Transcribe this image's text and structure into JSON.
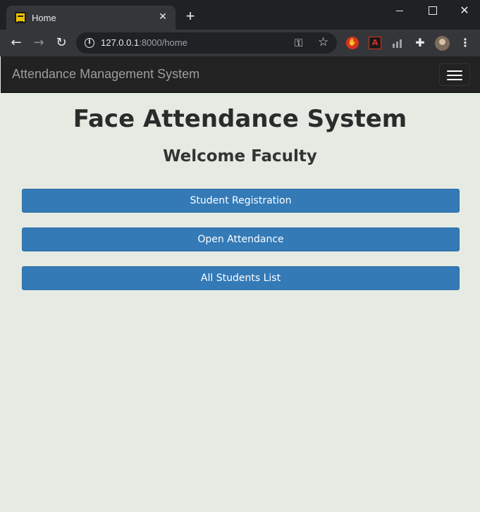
{
  "browser": {
    "tab_title": "Home",
    "tab_close_glyph": "✕",
    "new_tab_glyph": "+",
    "url_host": "127.0.0.1",
    "url_rest": ":8000/home",
    "icons": [
      "back-arrow-icon",
      "forward-arrow-icon",
      "reload-icon",
      "info-icon",
      "key-icon",
      "star-icon",
      "stop-hand-icon",
      "pdf-icon",
      "chart-icon",
      "puzzle-icon",
      "avatar",
      "menu-dots-icon"
    ]
  },
  "navbar": {
    "brand": "Attendance Management System",
    "background": "#222222",
    "brand_color": "#9d9d9d"
  },
  "main": {
    "title": "Face Attendance System",
    "subtitle": "Welcome Faculty",
    "buttons": [
      {
        "label": "Student Registration"
      },
      {
        "label": "Open Attendance"
      },
      {
        "label": "All Students List"
      }
    ],
    "button_color": "#337ab7",
    "background": "#e5ebe2"
  }
}
